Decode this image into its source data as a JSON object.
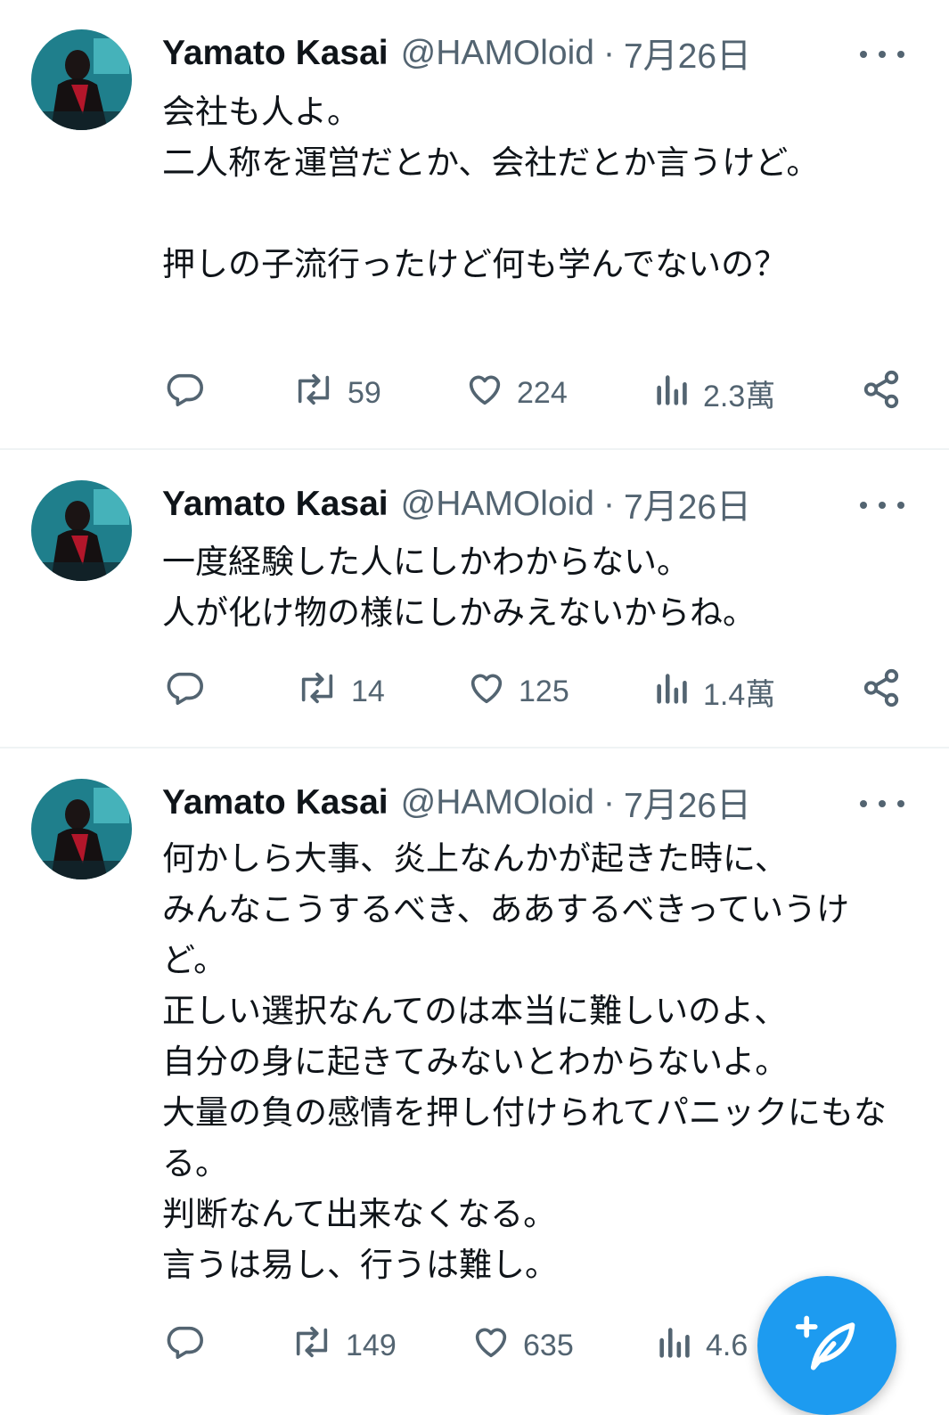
{
  "tweets": [
    {
      "name": "Yamato Kasai",
      "handle": "@HAMOloid",
      "separator": "·",
      "date": "7月26日",
      "text": "会社も人よ。\n二人称を運営だとか、会社だとか言うけど。\n\n押しの子流行ったけど何も学んでないの？",
      "reply_count": "",
      "retweet_count": "59",
      "like_count": "224",
      "view_count": "2.3萬"
    },
    {
      "name": "Yamato Kasai",
      "handle": "@HAMOloid",
      "separator": "·",
      "date": "7月26日",
      "text": "一度経験した人にしかわからない。\n人が化け物の様にしかみえないからね。",
      "reply_count": "",
      "retweet_count": "14",
      "like_count": "125",
      "view_count": "1.4萬"
    },
    {
      "name": "Yamato Kasai",
      "handle": "@HAMOloid",
      "separator": "·",
      "date": "7月26日",
      "text": "何かしら大事、炎上なんかが起きた時に、\nみんなこうするべき、ああするべきっていうけど。\n正しい選択なんてのは本当に難しいのよ、\n自分の身に起きてみないとわからないよ。\n大量の負の感情を押し付けられてパニックにもなる。\n判断なんて出来なくなる。\n言うは易し、行うは難し。",
      "reply_count": "",
      "retweet_count": "149",
      "like_count": "635",
      "view_count": "4.6"
    }
  ],
  "icons": {
    "reply": "reply-icon",
    "retweet": "retweet-icon",
    "like": "heart-icon",
    "views": "analytics-icon",
    "share": "share-icon",
    "more": "more-icon",
    "compose": "compose-icon"
  },
  "colors": {
    "text": "#0f1419",
    "secondary": "#536471",
    "accent": "#1d9bf0",
    "divider": "#eff3f4"
  }
}
